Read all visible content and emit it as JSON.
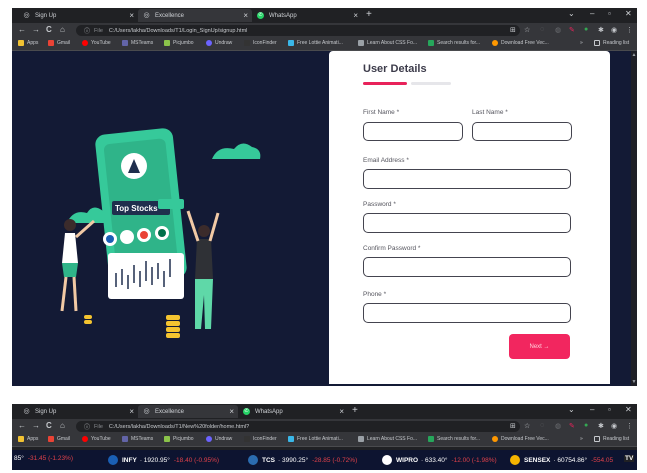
{
  "browser": {
    "tabs": [
      {
        "title": "Sign Up",
        "icon": "globe-icon",
        "active": false
      },
      {
        "title": "Excellence",
        "icon": "globe-icon",
        "active": true
      },
      {
        "title": "WhatsApp",
        "icon": "whatsapp-icon",
        "active": false
      }
    ],
    "new_tab": "+",
    "window": {
      "minimize": "⌄",
      "min": "–",
      "max": "▫",
      "close": "✕"
    },
    "nav": {
      "back": "←",
      "forward": "→",
      "reload": "C",
      "home": "⌂"
    },
    "file_label": "File",
    "url_top": "C:/Users/lakha/Downloads/T1/Login_SignUp/signup.html",
    "url_bottom": "C:/Users/lakha/Downloads/T1/New%20folder/home.html?",
    "bookmarks": [
      {
        "label": "Apps",
        "color": "#f1c232"
      },
      {
        "label": "Gmail",
        "color": "#ea4335"
      },
      {
        "label": "YouTube",
        "color": "#ff0000"
      },
      {
        "label": "MSTeams",
        "color": "#6264a7"
      },
      {
        "label": "Picjumbo",
        "color": "#8bc34a"
      },
      {
        "label": "Undraw",
        "color": "#6c63ff"
      },
      {
        "label": "IconFinder",
        "color": "#333333"
      },
      {
        "label": "Free Lottie Animati...",
        "color": "#3ab7e8"
      },
      {
        "label": "Learn About CSS Fo...",
        "color": "#9aa0a6"
      },
      {
        "label": "Search results for...",
        "color": "#26a65b"
      },
      {
        "label": "Download Free Vec...",
        "color": "#ff9800"
      }
    ],
    "more_bookmarks": "»",
    "reading_list": "Reading list"
  },
  "signup": {
    "title": "User Details",
    "first_name_label": "First Name *",
    "last_name_label": "Last Name *",
    "email_label": "Email Address *",
    "password_label": "Password *",
    "confirm_password_label": "Confirm Password *",
    "phone_label": "Phone *",
    "next_button": "Next →",
    "accent_color": "#f2265f"
  },
  "illustration": {
    "banner_text": "Top Stocks"
  },
  "ticker": [
    {
      "symbol": "",
      "price": "85°",
      "change": "-31.45 (-1.23%)"
    },
    {
      "symbol": "INFY",
      "price": "· 1920.95°",
      "change": "-18.40 (-0.95%)"
    },
    {
      "symbol": "TCS",
      "price": "· 3990.25°",
      "change": "-28.85 (-0.72%)"
    },
    {
      "symbol": "WIPRO",
      "price": "· 633.40°",
      "change": "-12.00 (-1.98%)"
    },
    {
      "symbol": "SENSEX",
      "price": "· 60754.86°",
      "change": "-554.05"
    }
  ],
  "ticker_badge": "TV"
}
